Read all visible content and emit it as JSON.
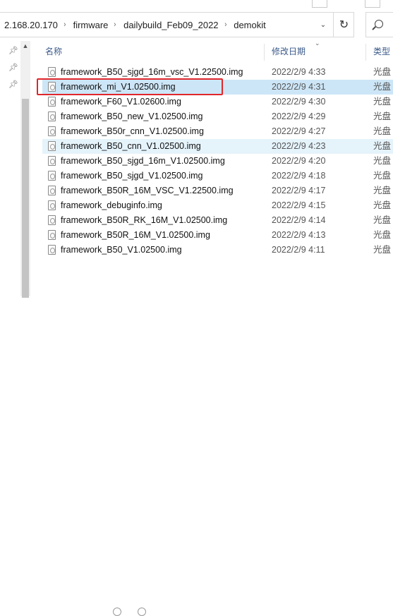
{
  "address_bar": {
    "crumbs": [
      "2.168.20.170",
      "firmware",
      "dailybuild_Feb09_2022",
      "demokit"
    ],
    "separator": "›",
    "dropdown_icon": "chevron-down-icon",
    "refresh_icon": "refresh-icon",
    "refresh_glyph": "↻"
  },
  "search": {
    "icon": "search-icon"
  },
  "columns": {
    "name": "名称",
    "date_modified": "修改日期",
    "type": "类型"
  },
  "files": [
    {
      "name": "framework_B50_sjgd_16m_vsc_V1.22500.img",
      "date": "2022/2/9 4:33",
      "type": "光盘"
    },
    {
      "name": "framework_mi_V1.02500.img",
      "date": "2022/2/9 4:31",
      "type": "光盘",
      "selected": true
    },
    {
      "name": "framework_F60_V1.02600.img",
      "date": "2022/2/9 4:30",
      "type": "光盘"
    },
    {
      "name": "framework_B50_new_V1.02500.img",
      "date": "2022/2/9 4:29",
      "type": "光盘"
    },
    {
      "name": "framework_B50r_cnn_V1.02500.img",
      "date": "2022/2/9 4:27",
      "type": "光盘"
    },
    {
      "name": "framework_B50_cnn_V1.02500.img",
      "date": "2022/2/9 4:23",
      "type": "光盘",
      "hover": true
    },
    {
      "name": "framework_B50_sjgd_16m_V1.02500.img",
      "date": "2022/2/9 4:20",
      "type": "光盘"
    },
    {
      "name": "framework_B50_sjgd_V1.02500.img",
      "date": "2022/2/9 4:18",
      "type": "光盘"
    },
    {
      "name": "framework_B50R_16M_VSC_V1.22500.img",
      "date": "2022/2/9 4:17",
      "type": "光盘"
    },
    {
      "name": "framework_debuginfo.img",
      "date": "2022/2/9 4:15",
      "type": "光盘"
    },
    {
      "name": "framework_B50R_RK_16M_V1.02500.img",
      "date": "2022/2/9 4:14",
      "type": "光盘"
    },
    {
      "name": "framework_B50R_16M_V1.02500.img",
      "date": "2022/2/9 4:13",
      "type": "光盘"
    },
    {
      "name": "framework_B50_V1.02500.img",
      "date": "2022/2/9 4:11",
      "type": "光盘"
    }
  ],
  "nav_pane": {
    "pin_icon": "pin-icon",
    "pin_count": 3
  },
  "colors": {
    "selected_row": "#cde6f7",
    "hover_row": "#e5f3fb",
    "highlight_border": "#e0262a",
    "header_text": "#3b5a8a"
  }
}
